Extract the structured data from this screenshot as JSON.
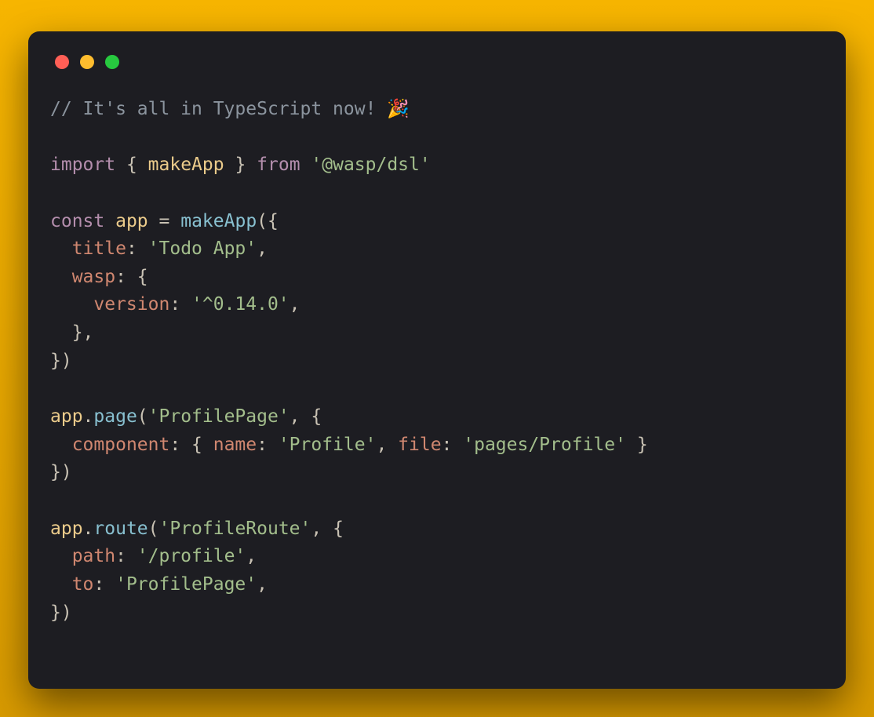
{
  "code": {
    "comment": "// It's all in TypeScript now! 🎉",
    "import_kw": "import",
    "from_kw": "from",
    "makeApp": "makeApp",
    "module": "'@wasp/dsl'",
    "const_kw": "const",
    "app_var": "app",
    "eq": "=",
    "open_call": "({",
    "title_key": "title",
    "title_val": "'Todo App'",
    "wasp_key": "wasp",
    "version_key": "version",
    "version_val": "'^0.14.0'",
    "close_inner": "},",
    "close_call": "})",
    "page_method": "page",
    "page_name": "'ProfilePage'",
    "component_key": "component",
    "name_key": "name",
    "name_val": "'Profile'",
    "file_key": "file",
    "file_val": "'pages/Profile'",
    "route_method": "route",
    "route_name": "'ProfileRoute'",
    "path_key": "path",
    "path_val": "'/profile'",
    "to_key": "to",
    "to_val": "'ProfilePage'",
    "lbrace": "{",
    "rbrace": "}",
    "lbrace_sp": "{ ",
    "rbrace_sp": " }",
    "comma": ",",
    "comma_sp": ", ",
    "colon": ": ",
    "dot": ".",
    "lparen": "(",
    "rparen": ")"
  }
}
